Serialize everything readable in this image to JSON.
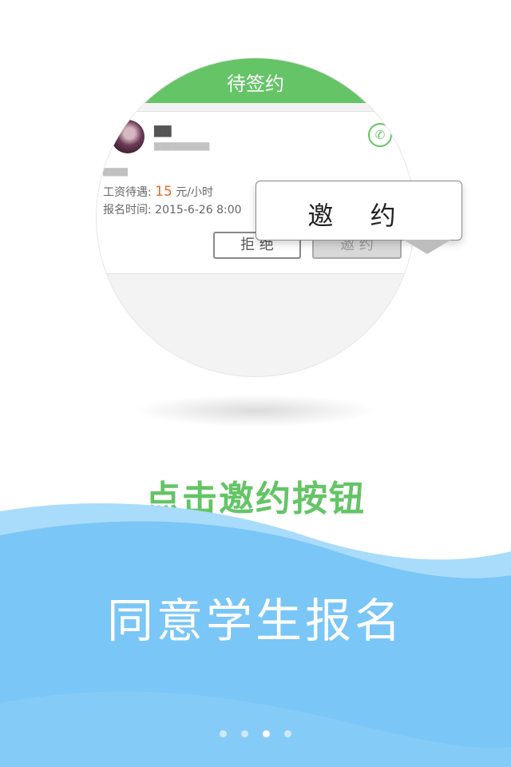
{
  "illustration": {
    "header_title": "待签约",
    "card": {
      "salary_label": "工资待遇:",
      "salary_value": "15",
      "salary_unit": "元/小时",
      "time_label": "报名时间:",
      "time_value": "2015-6-26 8:00",
      "reject_label": "拒 绝",
      "invite_label": "邀 约"
    },
    "popup_label": "邀 约",
    "icons": {
      "phone": "phone-icon",
      "avatar": "avatar-image"
    }
  },
  "headline": "点击邀约按钮",
  "subheadline": "同意学生报名",
  "pager": {
    "total": 4,
    "active_index": 2
  },
  "colors": {
    "accent_green": "#64c466",
    "wave_blue": "#7ac6f7",
    "wave_light": "#a9dbfb",
    "salary_orange": "#f0642a"
  }
}
